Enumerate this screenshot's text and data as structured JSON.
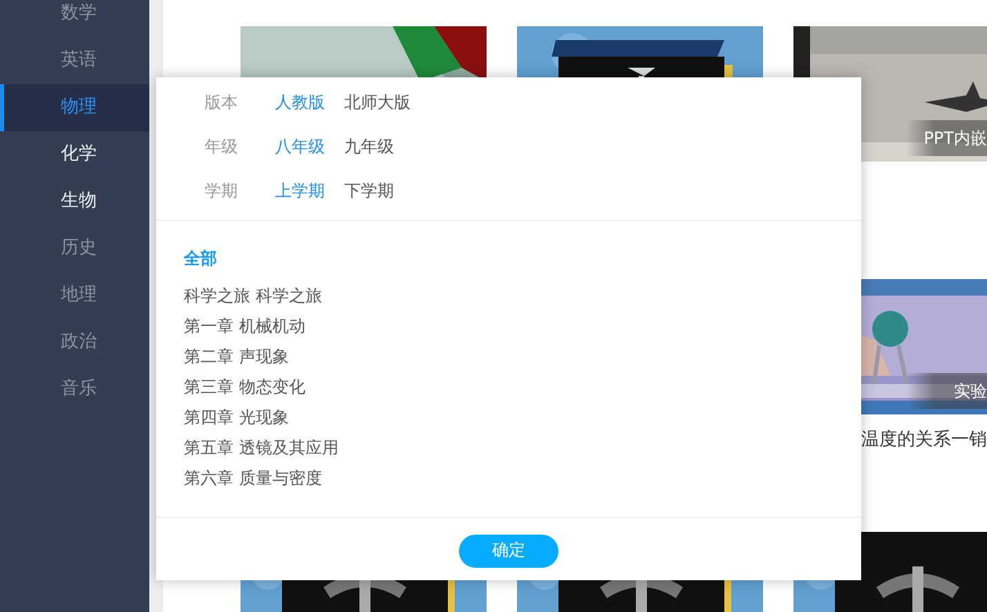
{
  "sidebar": {
    "items": [
      {
        "label": "数学",
        "selected": false,
        "dimmed": true
      },
      {
        "label": "英语",
        "selected": false,
        "dimmed": true
      },
      {
        "label": "物理",
        "selected": true,
        "dimmed": false
      },
      {
        "label": "化学",
        "selected": false,
        "dimmed": false
      },
      {
        "label": "生物",
        "selected": false,
        "dimmed": false
      },
      {
        "label": "历史",
        "selected": false,
        "dimmed": true
      },
      {
        "label": "地理",
        "selected": false,
        "dimmed": true
      },
      {
        "label": "政治",
        "selected": false,
        "dimmed": true
      },
      {
        "label": "音乐",
        "selected": false,
        "dimmed": true
      }
    ]
  },
  "cards": [
    {
      "kind": "picture"
    },
    {
      "kind": "picture"
    },
    {
      "kind": "picture",
      "overlay": "PPT内嵌"
    },
    {
      "kind": "covered"
    },
    {
      "kind": "covered"
    },
    {
      "kind": "picture",
      "overlay": "实验",
      "caption": "温度的关系一销"
    },
    {
      "kind": "picture"
    },
    {
      "kind": "picture"
    },
    {
      "kind": "picture"
    }
  ],
  "filter_dialog": {
    "filters": [
      {
        "label": "版本",
        "options": [
          {
            "label": "人教版",
            "selected": true
          },
          {
            "label": "北师大版",
            "selected": false
          }
        ]
      },
      {
        "label": "年级",
        "options": [
          {
            "label": "八年级",
            "selected": true
          },
          {
            "label": "九年级",
            "selected": false
          }
        ]
      },
      {
        "label": "学期",
        "options": [
          {
            "label": "上学期",
            "selected": true
          },
          {
            "label": "下学期",
            "selected": false
          }
        ]
      }
    ],
    "chapters": [
      {
        "label": "全部",
        "selected": true
      },
      {
        "label": "科学之旅 科学之旅",
        "selected": false
      },
      {
        "label": "第一章 机械机动",
        "selected": false
      },
      {
        "label": "第二章 声现象",
        "selected": false
      },
      {
        "label": "第三章 物态变化",
        "selected": false
      },
      {
        "label": "第四章 光现象",
        "selected": false
      },
      {
        "label": "第五章 透镜及其应用",
        "selected": false
      },
      {
        "label": "第六章 质量与密度",
        "selected": false
      }
    ],
    "confirm_button": "确定"
  }
}
